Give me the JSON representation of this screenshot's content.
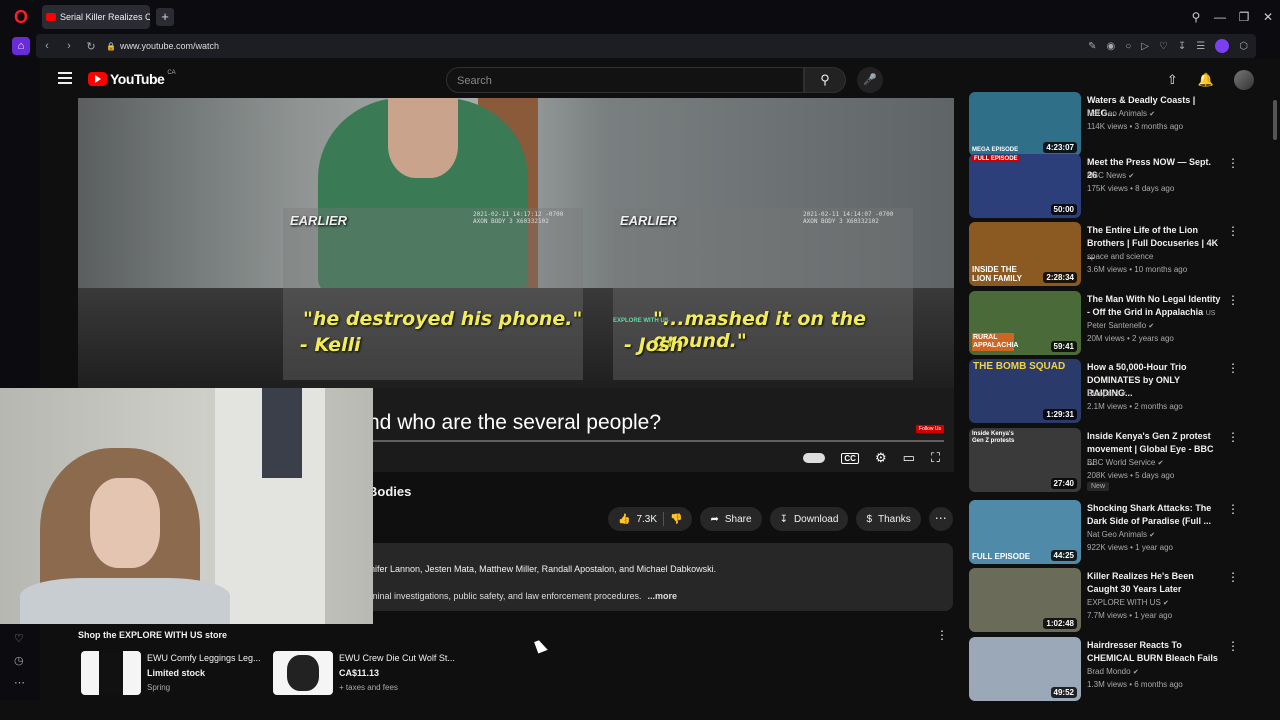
{
  "browser": {
    "tab_title": "Serial Killer Realizes Cops",
    "new_tab": "+",
    "url": "www.youtube.com/watch"
  },
  "youtube": {
    "logo_text": "YouTube",
    "country": "CA",
    "search_placeholder": "Search"
  },
  "video": {
    "label_left": "EARLIER",
    "label_right": "EARLIER",
    "stamp_left": "2021-02-11 14:17:12 -0700\nAXON BODY 3 X60332102",
    "stamp_right": "2021-02-11 14:14:07 -0700\nAXON BODY 3 X60332102",
    "caption_left": "\"he destroyed his phone.\"",
    "caption_left_name": "- Kelli",
    "caption_right": "\"...mashed it on the ground.\"",
    "caption_right_name": "- Josh",
    "watermark": "EXPLORE WITH US",
    "subtitle": "nd who are the several people?",
    "follow": "Follow Us"
  },
  "below": {
    "title_fragment": "Bodies",
    "likes": "7.3K",
    "share": "Share",
    "download": "Download",
    "thanks": "Thanks",
    "desc_line1": "nifer Lannon, Jesten Mata, Matthew Miller, Randall Apostalon, and Michael Dabkowski.",
    "desc_line2": "minal investigations, public safety, and law enforcement procedures.",
    "desc_more": "...more",
    "shop_title": "Shop the EXPLORE WITH US store",
    "products": [
      {
        "name": "EWU Comfy Leggings Leg...",
        "price": "Limited stock",
        "sub": "Spring"
      },
      {
        "name": "EWU Crew Die Cut Wolf St...",
        "price": "CA$11.13",
        "sub": "+ taxes and fees"
      }
    ]
  },
  "recommendations": [
    {
      "title": "Waters & Deadly Coasts | MEG...",
      "channel": "Nat Geo Animals",
      "meta": "114K views • 3 months ago",
      "duration": "4:23:07",
      "badge": "MEGA EPISODE",
      "color": "#2f6f88"
    },
    {
      "title": "Meet the Press NOW — Sept. 26",
      "channel": "NBC News",
      "meta": "175K views • 8 days ago",
      "duration": "50:00",
      "badge": "FULL EPISODE",
      "color": "#2c3f7a"
    },
    {
      "title": "The Entire Life of the Lion Brothers | Full Docuseries | 4K ...",
      "channel": "space and science",
      "meta": "3.6M views • 10 months ago",
      "duration": "2:28:34",
      "badge": "INSIDE THE LION FAMILY",
      "color": "#8a5a22"
    },
    {
      "title": "The Man With No Legal Identity - Off the Grid in Appalachia",
      "title_suffix": "US",
      "channel": "Peter Santenello",
      "meta": "20M views • 2 years ago",
      "duration": "59:41",
      "badge": "RURAL APPALACHIA",
      "color": "#4b6a3a"
    },
    {
      "title": "How a 50,000-Hour Trio DOMINATES by ONLY RAIDING...",
      "channel": "Blooprint",
      "meta": "2.1M views • 2 months ago",
      "duration": "1:29:31",
      "badge": "THE BOMB SQUAD",
      "color": "#2a3a6a"
    },
    {
      "title": "Inside Kenya's Gen Z protest movement | Global Eye - BBC ...",
      "channel": "BBC World Service",
      "meta": "208K views • 5 days ago",
      "duration": "27:40",
      "badge": "Inside Kenya's Gen Z protests",
      "color": "#3a3a3a",
      "is_new": "New"
    },
    {
      "title": "Shocking Shark Attacks: The Dark Side of Paradise (Full ...",
      "channel": "Nat Geo Animals",
      "meta": "922K views • 1 year ago",
      "duration": "44:25",
      "badge": "FULL EPISODE",
      "color": "#4f8aa8"
    },
    {
      "title": "Killer Realizes He's Been Caught 30 Years Later",
      "channel": "EXPLORE WITH US",
      "meta": "7.7M views • 1 year ago",
      "duration": "1:02:48",
      "badge": "",
      "color": "#6b6b5a"
    },
    {
      "title": "Hairdresser Reacts To CHEMICAL BURN Bleach Fails",
      "channel": "Brad Mondo",
      "meta": "1.3M views • 6 months ago",
      "duration": "49:52",
      "badge": "",
      "color": "#9aa8b8"
    }
  ]
}
